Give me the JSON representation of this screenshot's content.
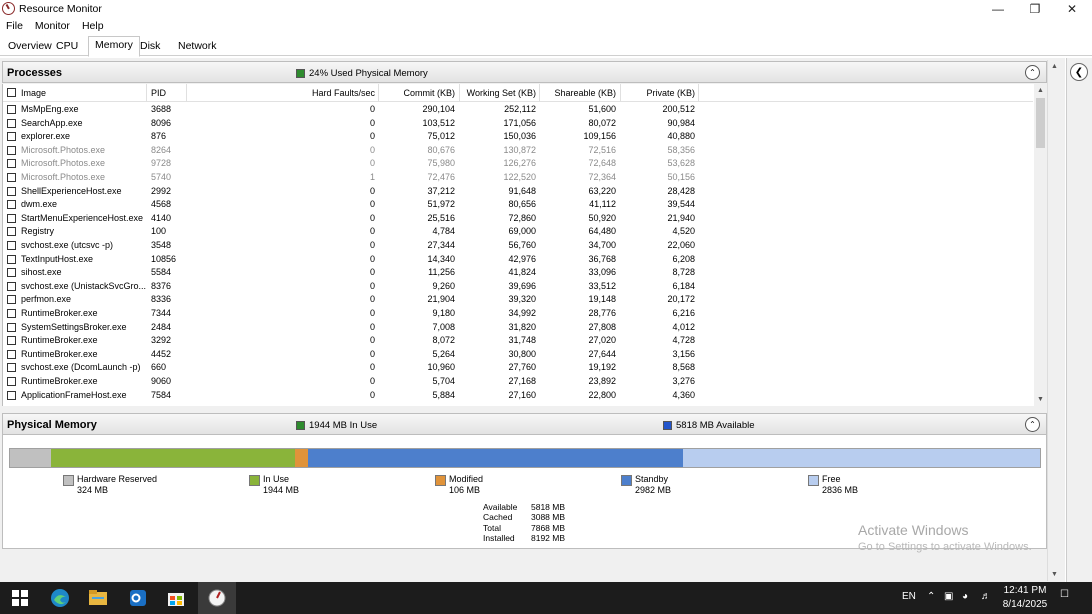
{
  "window": {
    "title": "Resource Monitor"
  },
  "menu": [
    "File",
    "Monitor",
    "Help"
  ],
  "tabs": [
    "Overview",
    "CPU",
    "Memory",
    "Disk",
    "Network"
  ],
  "processes": {
    "title": "Processes",
    "indicator": "24% Used Physical Memory",
    "indicator_color": "#2e8b2e",
    "columns": [
      "Image",
      "PID",
      "Hard Faults/sec",
      "Commit (KB)",
      "Working Set (KB)",
      "Shareable (KB)",
      "Private (KB)"
    ],
    "rows": [
      {
        "image": "MsMpEng.exe",
        "pid": "3688",
        "hf": "0",
        "commit": "290,104",
        "ws": "252,112",
        "share": "51,600",
        "priv": "200,512",
        "dim": false
      },
      {
        "image": "SearchApp.exe",
        "pid": "8096",
        "hf": "0",
        "commit": "103,512",
        "ws": "171,056",
        "share": "80,072",
        "priv": "90,984",
        "dim": false
      },
      {
        "image": "explorer.exe",
        "pid": "876",
        "hf": "0",
        "commit": "75,012",
        "ws": "150,036",
        "share": "109,156",
        "priv": "40,880",
        "dim": false
      },
      {
        "image": "Microsoft.Photos.exe",
        "pid": "8264",
        "hf": "0",
        "commit": "80,676",
        "ws": "130,872",
        "share": "72,516",
        "priv": "58,356",
        "dim": true
      },
      {
        "image": "Microsoft.Photos.exe",
        "pid": "9728",
        "hf": "0",
        "commit": "75,980",
        "ws": "126,276",
        "share": "72,648",
        "priv": "53,628",
        "dim": true
      },
      {
        "image": "Microsoft.Photos.exe",
        "pid": "5740",
        "hf": "1",
        "commit": "72,476",
        "ws": "122,520",
        "share": "72,364",
        "priv": "50,156",
        "dim": true
      },
      {
        "image": "ShellExperienceHost.exe",
        "pid": "2992",
        "hf": "0",
        "commit": "37,212",
        "ws": "91,648",
        "share": "63,220",
        "priv": "28,428",
        "dim": false
      },
      {
        "image": "dwm.exe",
        "pid": "4568",
        "hf": "0",
        "commit": "51,972",
        "ws": "80,656",
        "share": "41,112",
        "priv": "39,544",
        "dim": false
      },
      {
        "image": "StartMenuExperienceHost.exe",
        "pid": "4140",
        "hf": "0",
        "commit": "25,516",
        "ws": "72,860",
        "share": "50,920",
        "priv": "21,940",
        "dim": false
      },
      {
        "image": "Registry",
        "pid": "100",
        "hf": "0",
        "commit": "4,784",
        "ws": "69,000",
        "share": "64,480",
        "priv": "4,520",
        "dim": false
      },
      {
        "image": "svchost.exe (utcsvc -p)",
        "pid": "3548",
        "hf": "0",
        "commit": "27,344",
        "ws": "56,760",
        "share": "34,700",
        "priv": "22,060",
        "dim": false
      },
      {
        "image": "TextInputHost.exe",
        "pid": "10856",
        "hf": "0",
        "commit": "14,340",
        "ws": "42,976",
        "share": "36,768",
        "priv": "6,208",
        "dim": false
      },
      {
        "image": "sihost.exe",
        "pid": "5584",
        "hf": "0",
        "commit": "11,256",
        "ws": "41,824",
        "share": "33,096",
        "priv": "8,728",
        "dim": false
      },
      {
        "image": "svchost.exe (UnistackSvcGro...",
        "pid": "8376",
        "hf": "0",
        "commit": "9,260",
        "ws": "39,696",
        "share": "33,512",
        "priv": "6,184",
        "dim": false
      },
      {
        "image": "perfmon.exe",
        "pid": "8336",
        "hf": "0",
        "commit": "21,904",
        "ws": "39,320",
        "share": "19,148",
        "priv": "20,172",
        "dim": false
      },
      {
        "image": "RuntimeBroker.exe",
        "pid": "7344",
        "hf": "0",
        "commit": "9,180",
        "ws": "34,992",
        "share": "28,776",
        "priv": "6,216",
        "dim": false
      },
      {
        "image": "SystemSettingsBroker.exe",
        "pid": "2484",
        "hf": "0",
        "commit": "7,008",
        "ws": "31,820",
        "share": "27,808",
        "priv": "4,012",
        "dim": false
      },
      {
        "image": "RuntimeBroker.exe",
        "pid": "3292",
        "hf": "0",
        "commit": "8,072",
        "ws": "31,748",
        "share": "27,020",
        "priv": "4,728",
        "dim": false
      },
      {
        "image": "RuntimeBroker.exe",
        "pid": "4452",
        "hf": "0",
        "commit": "5,264",
        "ws": "30,800",
        "share": "27,644",
        "priv": "3,156",
        "dim": false
      },
      {
        "image": "svchost.exe (DcomLaunch -p)",
        "pid": "660",
        "hf": "0",
        "commit": "10,960",
        "ws": "27,760",
        "share": "19,192",
        "priv": "8,568",
        "dim": false
      },
      {
        "image": "RuntimeBroker.exe",
        "pid": "9060",
        "hf": "0",
        "commit": "5,704",
        "ws": "27,168",
        "share": "23,892",
        "priv": "3,276",
        "dim": false
      },
      {
        "image": "ApplicationFrameHost.exe",
        "pid": "7584",
        "hf": "0",
        "commit": "5,884",
        "ws": "27,160",
        "share": "22,800",
        "priv": "4,360",
        "dim": false
      }
    ]
  },
  "physical_memory": {
    "title": "Physical Memory",
    "in_use_label": "1944 MB In Use",
    "available_label": "5818 MB Available",
    "in_use_color": "#2e8b2e",
    "available_color": "#2255cc",
    "segments": [
      {
        "name": "Hardware Reserved",
        "value": "324 MB",
        "mb": 324,
        "color": "#c0c0c0"
      },
      {
        "name": "In Use",
        "value": "1944 MB",
        "mb": 1944,
        "color": "#8ab43a"
      },
      {
        "name": "Modified",
        "value": "106 MB",
        "mb": 106,
        "color": "#e0933a"
      },
      {
        "name": "Standby",
        "value": "2982 MB",
        "mb": 2982,
        "color": "#4d7fcc"
      },
      {
        "name": "Free",
        "value": "2836 MB",
        "mb": 2836,
        "color": "#b8cdef"
      }
    ],
    "summary": [
      {
        "k": "Available",
        "v": "5818 MB"
      },
      {
        "k": "Cached",
        "v": "3088 MB"
      },
      {
        "k": "Total",
        "v": "7868 MB"
      },
      {
        "k": "Installed",
        "v": "8192 MB"
      }
    ]
  },
  "watermark": {
    "line1": "Activate Windows",
    "line2": "Go to Settings to activate Windows."
  },
  "taskbar": {
    "lang": "EN",
    "time": "12:41 PM",
    "date": "8/14/2025"
  }
}
